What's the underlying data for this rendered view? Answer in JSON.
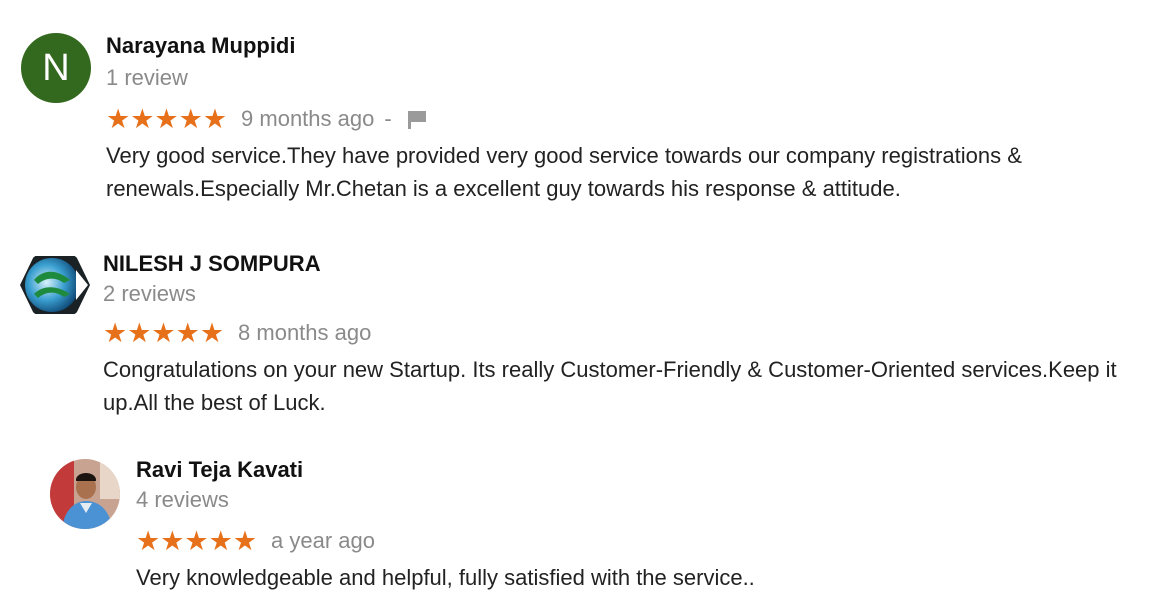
{
  "reviews": [
    {
      "avatar_letter": "N",
      "author": "Narayana Muppidi",
      "review_count": "1 review",
      "stars": "★★★★★",
      "rating": 5,
      "date": "9 months ago",
      "separator": "-",
      "text": "Very good service.They have provided very good service towards our company registrations & renewals.Especially Mr.Chetan is a excellent guy towards his response & attitude."
    },
    {
      "author": "NILESH J SOMPURA",
      "review_count": "2 reviews",
      "stars": "★★★★★",
      "rating": 5,
      "date": "8 months ago",
      "text": "Congratulations on your new Startup. Its really Customer-Friendly & Customer-Oriented services.Keep it up.All the best of Luck."
    },
    {
      "author": "Ravi Teja Kavati",
      "review_count": "4 reviews",
      "stars": "★★★★★",
      "rating": 5,
      "date": "a year ago",
      "text": "Very knowledgeable and helpful, fully satisfied with the service.."
    }
  ],
  "colors": {
    "star": "#e7711b",
    "avatar_green": "#33691e",
    "muted_text": "#8a8a8a"
  },
  "icons": {
    "flag": "flag-icon"
  }
}
